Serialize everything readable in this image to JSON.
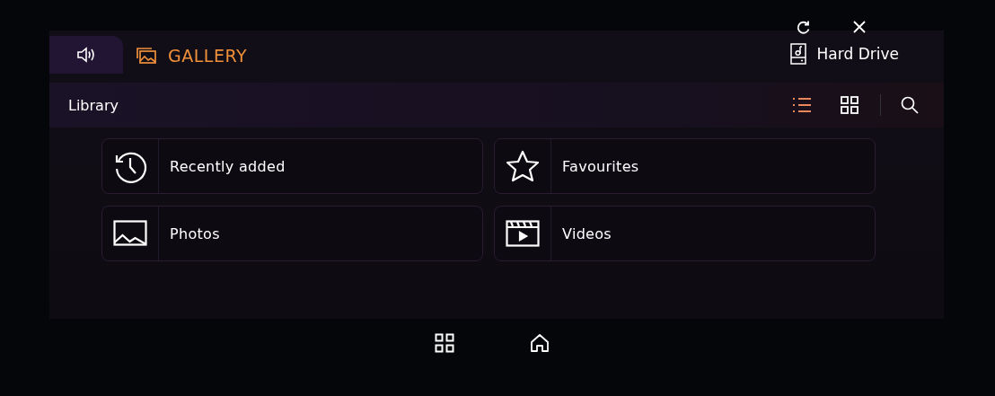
{
  "header": {
    "sound_button": {
      "selected": true
    },
    "title": "GALLERY",
    "source": "Hard Drive"
  },
  "toolbar": {
    "title": "Library",
    "views": [
      {
        "kind": "list",
        "selected": true
      },
      {
        "kind": "grid",
        "selected": false
      }
    ]
  },
  "categories": [
    {
      "kind": "recent",
      "label": "Recently added"
    },
    {
      "kind": "favourites",
      "label": "Favourites"
    },
    {
      "kind": "photos",
      "label": "Photos"
    },
    {
      "kind": "videos",
      "label": "Videos"
    }
  ],
  "bottom_nav": [
    {
      "kind": "apps"
    },
    {
      "kind": "home"
    }
  ]
}
